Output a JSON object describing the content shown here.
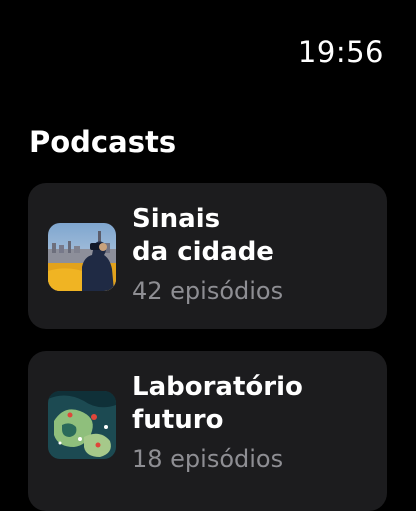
{
  "status_bar": {
    "time": "19:56"
  },
  "section": {
    "title": "Podcasts"
  },
  "podcasts": [
    {
      "title": "Sinais\nda cidade",
      "episodes": "42 episódios",
      "artwork_icon": "city-skyline-person-artwork"
    },
    {
      "title": "Laboratório\nfuturo",
      "episodes": "18 episódios",
      "artwork_icon": "abstract-map-artwork"
    }
  ],
  "colors": {
    "background": "#000000",
    "card": "#1c1c1e",
    "primary_text": "#ffffff",
    "secondary_text": "#8e8e93"
  }
}
